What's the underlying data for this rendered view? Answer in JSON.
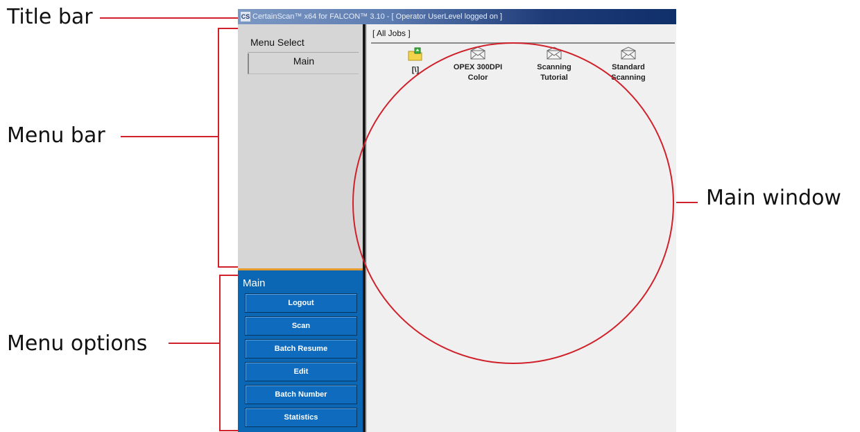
{
  "callouts": {
    "title_bar": "Title bar",
    "menu_bar": "Menu bar",
    "menu_options": "Menu options",
    "main_window": "Main window"
  },
  "window": {
    "title": "CertainScan™ x64 for FALCON™ 3.10 - [ Operator UserLevel logged on ]",
    "app_icon": "CS"
  },
  "menu_bar": {
    "heading": "Menu Select",
    "selected_tab": "Main"
  },
  "menu_options": {
    "heading": "Main",
    "buttons": [
      "Logout",
      "Scan",
      "Batch Resume",
      "Edit",
      "Batch Number",
      "Statistics"
    ]
  },
  "main_window": {
    "header": "[ All Jobs ]",
    "items": [
      {
        "label": "[\\]",
        "icon": "folder-up-icon"
      },
      {
        "label": "OPEX 300DPI\nColor",
        "icon": "envelope-icon"
      },
      {
        "label": "Scanning\nTutorial",
        "icon": "envelope-icon"
      },
      {
        "label": "Standard\nScanning",
        "icon": "envelope-icon"
      }
    ]
  },
  "colors": {
    "annotation_red": "#d0202a",
    "menu_options_blue": "#0b67b4",
    "separator_orange": "#e59a2c"
  }
}
